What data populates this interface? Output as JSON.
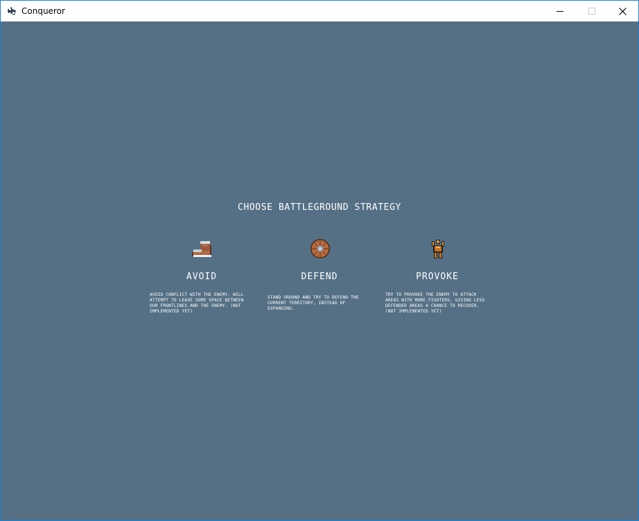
{
  "window": {
    "title": "Conqueror",
    "app_icon": "conqueror-app-icon",
    "controls": {
      "minimize_icon": "minimize-icon",
      "maximize_icon": "maximize-icon",
      "close_icon": "close-icon"
    }
  },
  "screen": {
    "headline": "CHOOSE BATTLEGROUND STRATEGY",
    "background_color": "#557085",
    "options": [
      {
        "label": "AVOID",
        "icon": "boot-icon",
        "description": "AVOID CONFLICT WITH THE ENEMY. WILL ATTEMPT TO LEAVE SOME SPACE BETWEEN OUR FRONTLINES AND THE ENEMY. (NOT IMPLEMENTED YET)"
      },
      {
        "label": "DEFEND",
        "icon": "round-shield-icon",
        "description": "STAND GROUND AND TRY TO DEFEND THE CURRENT TERRITORY, INSTEAD OF EXPANDING."
      },
      {
        "label": "PROVOKE",
        "icon": "provoking-figure-icon",
        "description": "TRY TO PROVOKE THE ENEMY TO ATTACK AREAS WITH MORE FIGHTERS, GIVING LESS DEFENDED AREAS A CHANCE TO RECOVER. (NOT IMPLEMENTED YET)"
      }
    ]
  }
}
